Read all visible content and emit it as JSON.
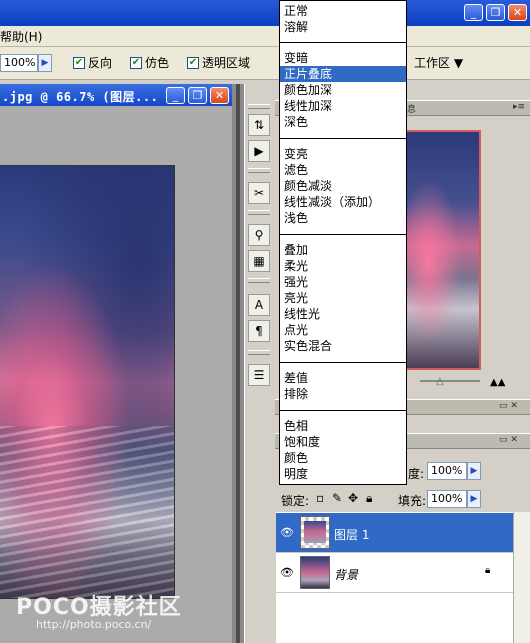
{
  "window": {
    "minimize_label": "_",
    "restore_label": "❐",
    "close_label": "✕"
  },
  "menubar": {
    "help_label": "帮助(H)"
  },
  "options": {
    "opacity_value": "100%",
    "reverse_label": "反向",
    "dither_label": "仿色",
    "transparency_label": "透明区域",
    "workspace_label": "工作区 ▼"
  },
  "document": {
    "title": ".jpg @ 66.7% (图层..."
  },
  "blend_modes": {
    "group1": [
      "正常",
      "溶解"
    ],
    "group2": [
      "变暗",
      "正片叠底",
      "颜色加深",
      "线性加深",
      "深色"
    ],
    "group3": [
      "变亮",
      "滤色",
      "颜色减淡",
      "线性减淡（添加）",
      "浅色"
    ],
    "group4": [
      "叠加",
      "柔光",
      "强光",
      "亮光",
      "线性光",
      "点光",
      "实色混合"
    ],
    "group5": [
      "差值",
      "排除"
    ],
    "group6": [
      "色相",
      "饱和度",
      "颜色",
      "明度"
    ],
    "selected": "正片叠底"
  },
  "panels": {
    "info_tab_fragment": "息",
    "opacity_label_fragment": "度:",
    "opacity_value": "100%",
    "lock_label": "锁定:",
    "fill_label": "填充:",
    "fill_value": "100%"
  },
  "layers": [
    {
      "name": "图层 1",
      "selected": true
    },
    {
      "name": "背景",
      "selected": false
    }
  ],
  "watermark": {
    "brand": "POCO摄影社区",
    "url": "http://photo.poco.cn/"
  },
  "colors": {
    "selection_blue": "#316ac5",
    "title_blue": "#1447c9",
    "nav_frame_red": "#d25c5c"
  }
}
